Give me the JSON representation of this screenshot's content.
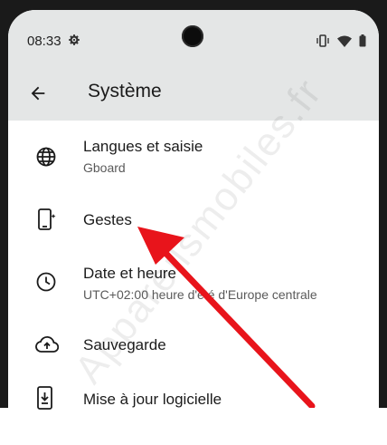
{
  "status_bar": {
    "time": "08:33",
    "icons": [
      "gear-icon",
      "vibrate-icon",
      "wifi-icon",
      "battery-icon"
    ]
  },
  "app_bar": {
    "back_icon": "arrow-left-icon",
    "title": "Système"
  },
  "settings_items": [
    {
      "icon": "globe-icon",
      "label": "Langues et saisie",
      "summary": "Gboard"
    },
    {
      "icon": "phone-gesture-icon",
      "label": "Gestes",
      "summary": ""
    },
    {
      "icon": "clock-icon",
      "label": "Date et heure",
      "summary": "UTC+02:00 heure d'été d'Europe centrale"
    },
    {
      "icon": "cloud-upload-icon",
      "label": "Sauvegarde",
      "summary": ""
    },
    {
      "icon": "system-update-icon",
      "label": "Mise à jour logicielle",
      "summary": ""
    }
  ],
  "watermark": "Appareilsmobiles.fr",
  "annotation": {
    "color": "#e8141b",
    "points_to": "Gestes"
  },
  "colors": {
    "status_bg": "#e4e6e6",
    "bezel": "#1a1a1a",
    "text": "#1b1b1b",
    "secondary": "#5a5a5a"
  }
}
